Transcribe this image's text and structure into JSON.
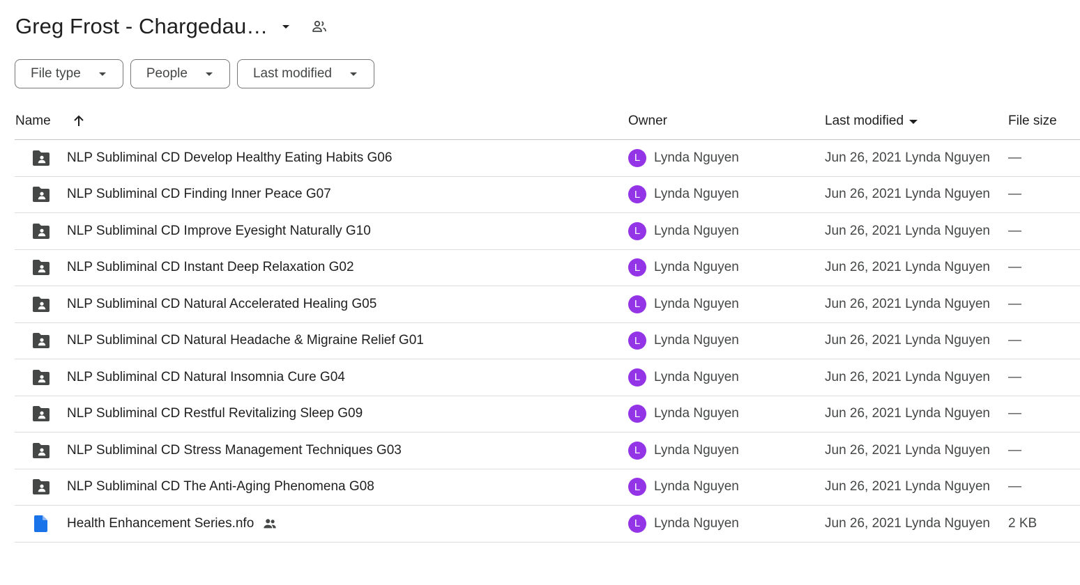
{
  "header": {
    "folder_title": "Greg Frost - Chargedau…",
    "caret_icon": "arrow-drop-down-icon",
    "shared_icon": "people-icon"
  },
  "filters": [
    {
      "label": "File type"
    },
    {
      "label": "People"
    },
    {
      "label": "Last modified"
    }
  ],
  "table": {
    "columns": {
      "name": "Name",
      "owner": "Owner",
      "last_modified": "Last modified",
      "file_size": "File size"
    },
    "rows": [
      {
        "type": "shared-folder",
        "name": "NLP Subliminal CD Develop Healthy Eating Habits G06",
        "owner_initial": "L",
        "owner": "Lynda Nguyen",
        "modified": "Jun 26, 2021 Lynda Nguyen",
        "size": "—"
      },
      {
        "type": "shared-folder",
        "name": "NLP Subliminal CD Finding Inner Peace G07",
        "owner_initial": "L",
        "owner": "Lynda Nguyen",
        "modified": "Jun 26, 2021 Lynda Nguyen",
        "size": "—"
      },
      {
        "type": "shared-folder",
        "name": "NLP Subliminal CD Improve Eyesight Naturally G10",
        "owner_initial": "L",
        "owner": "Lynda Nguyen",
        "modified": "Jun 26, 2021 Lynda Nguyen",
        "size": "—"
      },
      {
        "type": "shared-folder",
        "name": "NLP Subliminal CD Instant Deep Relaxation G02",
        "owner_initial": "L",
        "owner": "Lynda Nguyen",
        "modified": "Jun 26, 2021 Lynda Nguyen",
        "size": "—"
      },
      {
        "type": "shared-folder",
        "name": "NLP Subliminal CD Natural Accelerated Healing G05",
        "owner_initial": "L",
        "owner": "Lynda Nguyen",
        "modified": "Jun 26, 2021 Lynda Nguyen",
        "size": "—"
      },
      {
        "type": "shared-folder",
        "name": "NLP Subliminal CD Natural Headache & Migraine Relief G01",
        "owner_initial": "L",
        "owner": "Lynda Nguyen",
        "modified": "Jun 26, 2021 Lynda Nguyen",
        "size": "—"
      },
      {
        "type": "shared-folder",
        "name": "NLP Subliminal CD Natural Insomnia Cure G04",
        "owner_initial": "L",
        "owner": "Lynda Nguyen",
        "modified": "Jun 26, 2021 Lynda Nguyen",
        "size": "—"
      },
      {
        "type": "shared-folder",
        "name": "NLP Subliminal CD Restful Revitalizing Sleep G09",
        "owner_initial": "L",
        "owner": "Lynda Nguyen",
        "modified": "Jun 26, 2021 Lynda Nguyen",
        "size": "—"
      },
      {
        "type": "shared-folder",
        "name": "NLP Subliminal CD Stress Management Techniques G03",
        "owner_initial": "L",
        "owner": "Lynda Nguyen",
        "modified": "Jun 26, 2021 Lynda Nguyen",
        "size": "—"
      },
      {
        "type": "shared-folder",
        "name": "NLP Subliminal CD The Anti-Aging Phenomena G08",
        "owner_initial": "L",
        "owner": "Lynda Nguyen",
        "modified": "Jun 26, 2021 Lynda Nguyen",
        "size": "—"
      },
      {
        "type": "document",
        "name": "Health Enhancement Series.nfo",
        "shared": true,
        "owner_initial": "L",
        "owner": "Lynda Nguyen",
        "modified": "Jun 26, 2021 Lynda Nguyen",
        "size": "2 KB"
      }
    ]
  },
  "colors": {
    "avatar": "#9334e6",
    "folder_icon": "#444746",
    "doc_icon": "#1a73e8",
    "divider": "#dadce0"
  }
}
